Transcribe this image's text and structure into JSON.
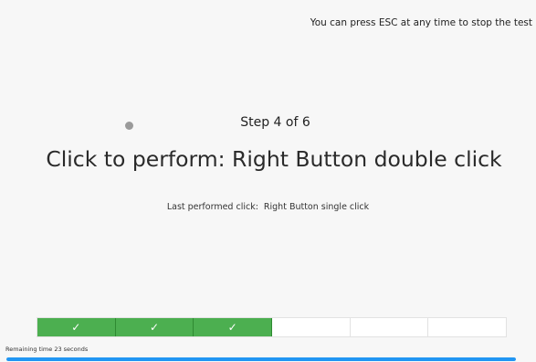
{
  "header": {
    "esc_hint": "You can press ESC at any time to stop the test"
  },
  "test": {
    "step_text": "Step 4 of 6",
    "current_step": 4,
    "total_steps": 6,
    "instruction": "Click to perform: Right Button double click",
    "last_click_label": "Last performed click:",
    "last_click_value": "Right Button single click"
  },
  "progress": {
    "steps": [
      {
        "status": "done",
        "mark": "✓"
      },
      {
        "status": "done",
        "mark": "✓"
      },
      {
        "status": "done",
        "mark": "✓"
      },
      {
        "status": "pending",
        "mark": ""
      },
      {
        "status": "pending",
        "mark": ""
      },
      {
        "status": "pending",
        "mark": ""
      }
    ],
    "done_color": "#4caf50"
  },
  "timer": {
    "remaining_text": "Remaining time 23 seconds",
    "remaining_fraction": 1.0,
    "bar_color": "#2196f3"
  }
}
